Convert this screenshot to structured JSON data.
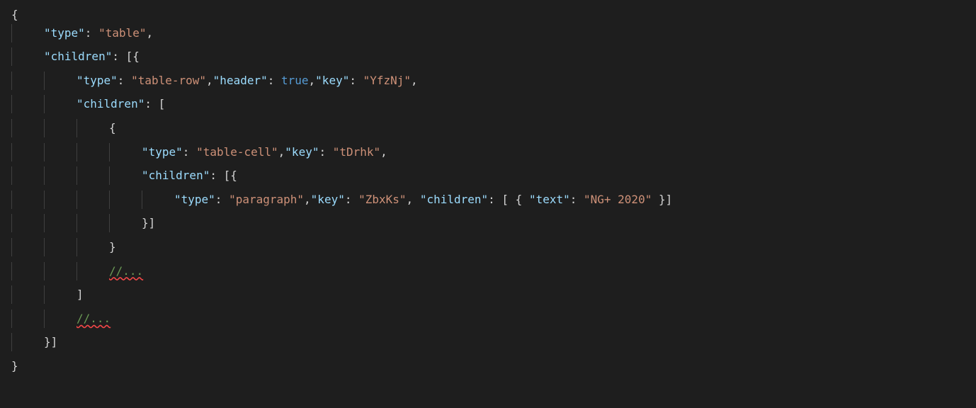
{
  "lines": [
    {
      "indent": 0,
      "segments": [
        {
          "t": "{",
          "c": "punct"
        }
      ]
    },
    {
      "indent": 1,
      "segments": [
        {
          "t": "\"type\"",
          "c": "key"
        },
        {
          "t": ": ",
          "c": "punct"
        },
        {
          "t": "\"table\"",
          "c": "string"
        },
        {
          "t": ",",
          "c": "punct"
        }
      ]
    },
    {
      "indent": 1,
      "segments": [
        {
          "t": "\"children\"",
          "c": "key"
        },
        {
          "t": ": [{",
          "c": "punct"
        }
      ]
    },
    {
      "indent": 2,
      "segments": [
        {
          "t": "\"type\"",
          "c": "key"
        },
        {
          "t": ": ",
          "c": "punct"
        },
        {
          "t": "\"table-row\"",
          "c": "string"
        },
        {
          "t": ",",
          "c": "punct"
        },
        {
          "t": "\"header\"",
          "c": "key"
        },
        {
          "t": ": ",
          "c": "punct"
        },
        {
          "t": "true",
          "c": "bool"
        },
        {
          "t": ",",
          "c": "punct"
        },
        {
          "t": "\"key\"",
          "c": "key"
        },
        {
          "t": ": ",
          "c": "punct"
        },
        {
          "t": "\"YfzNj\"",
          "c": "string"
        },
        {
          "t": ",",
          "c": "punct"
        }
      ]
    },
    {
      "indent": 2,
      "segments": [
        {
          "t": "\"children\"",
          "c": "key"
        },
        {
          "t": ": [",
          "c": "punct"
        }
      ]
    },
    {
      "indent": 3,
      "segments": [
        {
          "t": "{",
          "c": "punct"
        }
      ]
    },
    {
      "indent": 4,
      "segments": [
        {
          "t": "\"type\"",
          "c": "key"
        },
        {
          "t": ": ",
          "c": "punct"
        },
        {
          "t": "\"table-cell\"",
          "c": "string"
        },
        {
          "t": ",",
          "c": "punct"
        },
        {
          "t": "\"key\"",
          "c": "key"
        },
        {
          "t": ": ",
          "c": "punct"
        },
        {
          "t": "\"tDrhk\"",
          "c": "string"
        },
        {
          "t": ",",
          "c": "punct"
        }
      ]
    },
    {
      "indent": 4,
      "segments": [
        {
          "t": "\"children\"",
          "c": "key"
        },
        {
          "t": ": [{",
          "c": "punct"
        }
      ]
    },
    {
      "indent": 5,
      "segments": [
        {
          "t": "\"type\"",
          "c": "key"
        },
        {
          "t": ": ",
          "c": "punct"
        },
        {
          "t": "\"paragraph\"",
          "c": "string"
        },
        {
          "t": ",",
          "c": "punct"
        },
        {
          "t": "\"key\"",
          "c": "key"
        },
        {
          "t": ": ",
          "c": "punct"
        },
        {
          "t": "\"ZbxKs\"",
          "c": "string"
        },
        {
          "t": ", ",
          "c": "punct"
        },
        {
          "t": "\"children\"",
          "c": "key"
        },
        {
          "t": ": [ { ",
          "c": "punct"
        },
        {
          "t": "\"text\"",
          "c": "key"
        },
        {
          "t": ": ",
          "c": "punct"
        },
        {
          "t": "\"NG+ 2020\"",
          "c": "string"
        },
        {
          "t": " }]",
          "c": "punct"
        }
      ]
    },
    {
      "indent": 4,
      "segments": [
        {
          "t": "}]",
          "c": "punct"
        }
      ]
    },
    {
      "indent": 3,
      "segments": [
        {
          "t": "}",
          "c": "punct"
        }
      ]
    },
    {
      "indent": 3,
      "segments": [
        {
          "t": "//...",
          "c": "comment",
          "squiggle": true
        }
      ]
    },
    {
      "indent": 2,
      "segments": [
        {
          "t": "]",
          "c": "punct"
        }
      ]
    },
    {
      "indent": 2,
      "segments": [
        {
          "t": "//...",
          "c": "comment",
          "squiggle": true
        }
      ]
    },
    {
      "indent": 1,
      "segments": [
        {
          "t": "}]",
          "c": "punct"
        }
      ]
    },
    {
      "indent": 0,
      "segments": [
        {
          "t": "}",
          "c": "punct"
        }
      ]
    }
  ]
}
